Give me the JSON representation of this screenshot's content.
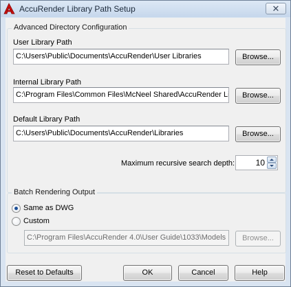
{
  "window": {
    "title": "AccuRender Library Path Setup",
    "close_glyph": "✕"
  },
  "advanced": {
    "legend": "Advanced Directory Configuration",
    "user_library": {
      "label": "User Library Path",
      "value": "C:\\Users\\Public\\Documents\\AccuRender\\User Libraries",
      "browse_label": "Browse..."
    },
    "internal_library": {
      "label": "Internal Library Path",
      "value": "C:\\Program Files\\Common Files\\McNeel Shared\\AccuRender Lib",
      "browse_label": "Browse..."
    },
    "default_library": {
      "label": "Default Library Path",
      "value": "C:\\Users\\Public\\Documents\\AccuRender\\Libraries",
      "browse_label": "Browse..."
    },
    "search_depth": {
      "label": "Maximum recursive search depth:",
      "value": "10"
    }
  },
  "batch": {
    "legend": "Batch Rendering Output",
    "options": [
      {
        "label": "Same as DWG",
        "checked": true
      },
      {
        "label": "Custom",
        "checked": false
      }
    ],
    "custom_path": "C:\\Program Files\\AccuRender 4.0\\User Guide\\1033\\Models",
    "browse_label": "Browse..."
  },
  "footer": {
    "reset_label": "Reset to Defaults",
    "ok_label": "OK",
    "cancel_label": "Cancel",
    "help_label": "Help"
  },
  "colors": {
    "frame": "#d9e4f1",
    "client": "#f0f0f0",
    "app_icon_red": "#cc1010",
    "radio_dot": "#1c4f97"
  }
}
